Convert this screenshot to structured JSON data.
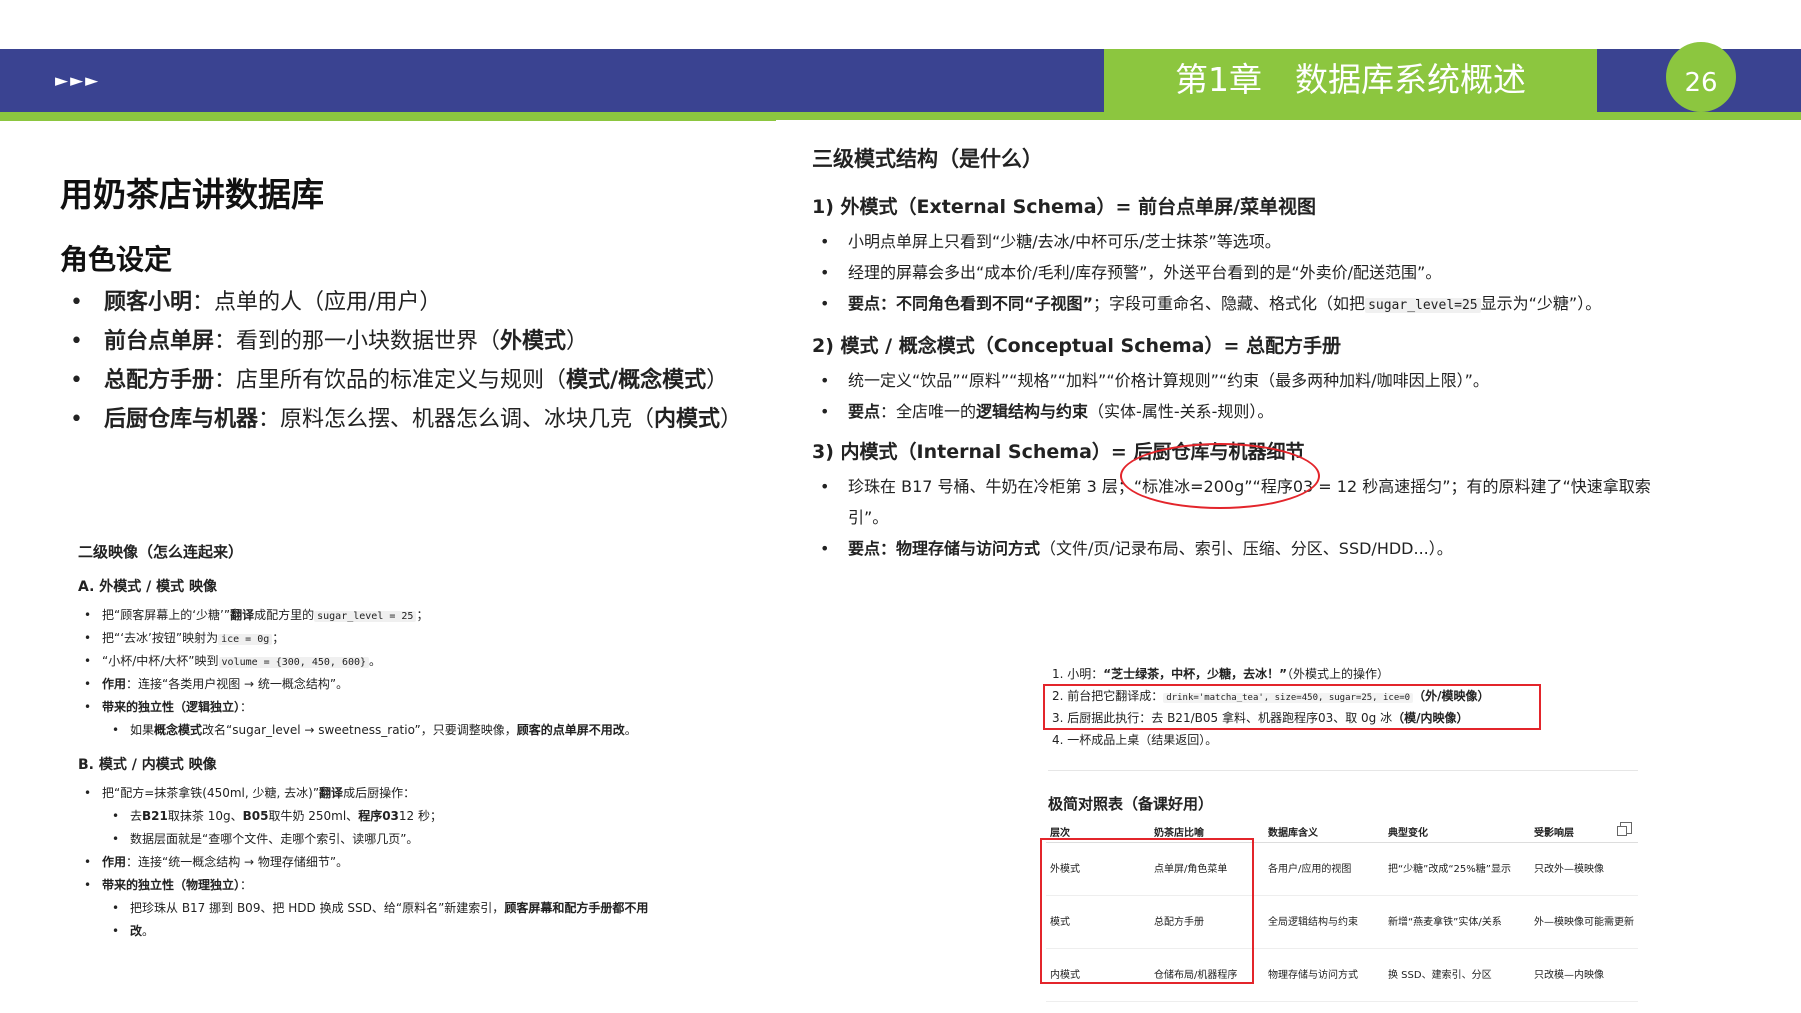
{
  "header": {
    "arrows": "►►►",
    "chapter_title": "第1章　数据库系统概述",
    "page_number": "26",
    "colors": {
      "bar": "#3a4391",
      "accent": "#8cc63f",
      "annotation": "#e3252b"
    }
  },
  "left": {
    "title": "用奶茶店讲数据库",
    "subtitle": "角色设定",
    "roles": [
      {
        "name": "顾客小明",
        "desc": "：点单的人（应用/用户）",
        "tag": "",
        "tail": ""
      },
      {
        "name": "前台点单屏",
        "desc": "：看到的那一小块数据世界（",
        "tag": "外模式",
        "tail": "）"
      },
      {
        "name": "总配方手册",
        "desc": "：店里所有饮品的标准定义与规则（",
        "tag": "模式/概念模式",
        "tail": "）"
      },
      {
        "name": "后厨仓库与机器",
        "desc": "：原料怎么摆、机器怎么调、冰块几克（",
        "tag": "内模式",
        "tail": "）"
      }
    ],
    "mapping": {
      "title": "二级映像（怎么连起来）",
      "a_title": "A. 外模式 / 模式 映像",
      "a1_pre": "把“顾客屏幕上的‘少糖’”",
      "a1_bold": "翻译",
      "a1_mid": "成配方里的",
      "a1_code": "sugar_level = 25",
      "a1_end": "；",
      "a2_pre": "把“‘去冰’按钮”映射为",
      "a2_code": "ice = 0g",
      "a2_end": "；",
      "a3_pre": "“小杯/中杯/大杯”映到",
      "a3_code": "volume = {300, 450, 600}",
      "a3_end": "。",
      "a4_bold": "作用",
      "a4_text": "：连接“各类用户视图 → 统一概念结构”。",
      "a5_bold": "带来的独立性（逻辑独立）",
      "a5_end": "：",
      "a6_pre": "如果",
      "a6_bold1": "概念模式",
      "a6_mid": "改名“sugar_level → sweetness_ratio”，只要调整映像，",
      "a6_bold2": "顾客的点单屏不用改",
      "a6_end": "。",
      "b_title": "B. 模式 / 内模式 映像",
      "b1_pre": "把“配方=抹茶拿铁(450ml, 少糖, 去冰)”",
      "b1_bold": "翻译",
      "b1_end": "成后厨操作：",
      "b2_pre": "去",
      "b2_b1": "B21",
      "b2_t1": "取抹茶 10g、",
      "b2_b2": "B05",
      "b2_t2": "取牛奶 250ml、",
      "b2_b3": "程序03",
      "b2_t3": "12 秒；",
      "b3": "数据层面就是“查哪个文件、走哪个索引、读哪几页”。",
      "b4_bold": "作用",
      "b4_text": "：连接“统一概念结构 → 物理存储细节”。",
      "b5_bold": "带来的独立性（物理独立）",
      "b5_end": "：",
      "b6_pre": "把珍珠从 B17 挪到 B09、把 HDD 换成 SSD、给“原料名”新建索引，",
      "b6_bold": "顾客屏幕和配方手册都不用",
      "b6_cont": "改",
      "b6_end": "。"
    }
  },
  "right": {
    "title": "三级模式结构（是什么）",
    "s1": "1) 外模式（External Schema）= 前台点单屏/菜单视图",
    "s1_r1": "小明点单屏上只看到“少糖/去冰/中杯可乐/芝士抹茶”等选项。",
    "s1_r2": "经理的屏幕会多出“成本价/毛利/库存预警”，外送平台看到的是“外卖价/配送范围”。",
    "s1_r3_bold": "要点：不同角色看到不同“子视图”",
    "s1_r3_text": "；字段可重命名、隐藏、格式化（如把",
    "s1_r3_code": "sugar_level=25",
    "s1_r3_end": "显示为“少糖”）。",
    "s2": "2) 模式 / 概念模式（Conceptual Schema）= 总配方手册",
    "s2_r1": "统一定义“饮品”“原料”“规格”“加料”“价格计算规则”“约束（最多两种加料/咖啡因上限）”。",
    "s2_r2_bold": "要点",
    "s2_r2_text": "：全店唯一的",
    "s2_r2_bold2": "逻辑结构与约束",
    "s2_r2_end": "（实体-属性-关系-规则）。",
    "s3": "3) 内模式（Internal Schema）= 后厨仓库与机器细节",
    "s3_r1": "珍珠在 B17 号桶、牛奶在冷柜第 3 层；“标准冰=200g”“程序03 = 12 秒高速摇匀”；有的原料建了“快速拿取索引”。",
    "s3_r2_bold": "要点：物理存储与访问方式",
    "s3_r2_text": "（文件/页/记录布局、索引、压缩、分区、SSD/HDD...）。",
    "steps": {
      "st1_pre": "1. 小明：",
      "st1_bold": "“芝士绿茶，中杯，少糖，去冰！”",
      "st1_end": "（外模式上的操作）",
      "st2_pre": "2. 前台把它翻译成：",
      "st2_code": "drink='matcha_tea', size=450, sugar=25, ice=0",
      "st2_bold": "（外/模映像）",
      "st3_pre": "3. 后厨据此执行：去 B21/B05 拿料、机器跑程序03、取 0g 冰",
      "st3_bold": "（模/内映像）",
      "st4": "4. 一杯成品上桌（结果返回）。"
    },
    "table": {
      "title": "极简对照表（备课好用）",
      "headers": [
        "层次",
        "奶茶店比喻",
        "数据库含义",
        "典型变化",
        "受影响层"
      ],
      "rows": [
        [
          "外模式",
          "点单屏/角色菜单",
          "各用户/应用的视图",
          "把“少糖”改成“25%糖”显示",
          "只改外—模映像"
        ],
        [
          "模式",
          "总配方手册",
          "全局逻辑结构与约束",
          "新增“燕麦拿铁”实体/关系",
          "外—模映像可能需更新"
        ],
        [
          "内模式",
          "仓储布局/机器程序",
          "物理存储与访问方式",
          "换 SSD、建索引、分区",
          "只改模—内映像"
        ]
      ]
    }
  }
}
